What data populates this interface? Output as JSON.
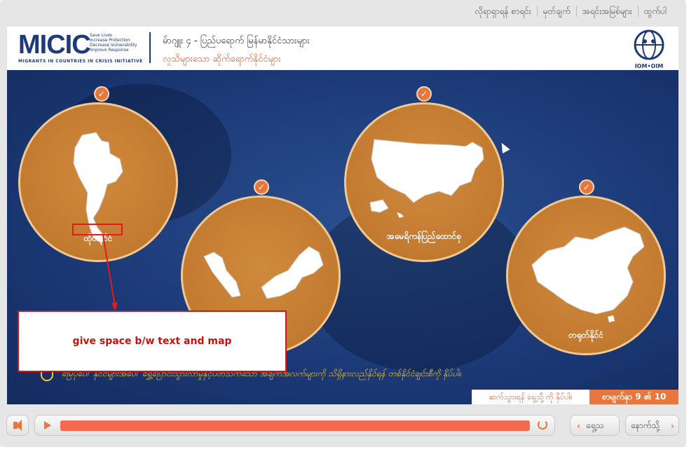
{
  "top_nav": [
    "လိုရာရှာရန် စာရင်း",
    "မှတ်ချက်",
    "အရင်းအမြစ်များ",
    "ထွက်ပါ"
  ],
  "header": {
    "logo": "MICIC",
    "tagline": [
      "Save Lives",
      "Increase Protection",
      "Decrease Vulnerability",
      "Improve Response"
    ],
    "logo_sub": "MIGRANTS IN COUNTRIES IN CRISIS INITIATIVE",
    "module_title": "မ်ာဂျူး ၄ - ပြည်ပရောက် မြန်မာနိုင်ငံသားများ",
    "module_subtitle": "လူသိများသော ဆိုက်ရောက်နိုင်ငံများ",
    "org_logo": "IOM•OIM"
  },
  "countries": [
    {
      "name": "ထိုင်းနိုင်ငံ",
      "map": "thailand"
    },
    {
      "name": "",
      "map": "malaysia"
    },
    {
      "name": "အမေရိကန်ပြည်ထောင်စု",
      "map": "usa"
    },
    {
      "name": "တရုတ်နိုင်ငံ",
      "map": "china"
    }
  ],
  "instruction": "မြေပုံပေါ် နိုင်ငံများအပေါ် ရွှေ့ပြောင်းသွားလာမှုနှင့်ပတ်သက်သော အချက်အလက်များကို သိရှိနားလည်နိုင်ရန် တစ်နိုင်ငံချင်းစီကို နှိပ်ပါ။",
  "annotation": "give space b/w text and map",
  "footer": {
    "next_hint": "ဆက်သွားရန် ရှေ့သို့ ကို နှိပ်ပါ။",
    "page_label": "စာမျက်နှာ",
    "page_current": "9",
    "page_of": "၏",
    "page_total": "10"
  },
  "controls": {
    "prev_label": "ရှေ့သ",
    "next_label": "နောက်သို့",
    "progress": 1.0
  },
  "colors": {
    "accent": "#e8773d",
    "progress": "#f26d4f",
    "brand": "#1e3a7a",
    "annotation": "#d21515"
  }
}
